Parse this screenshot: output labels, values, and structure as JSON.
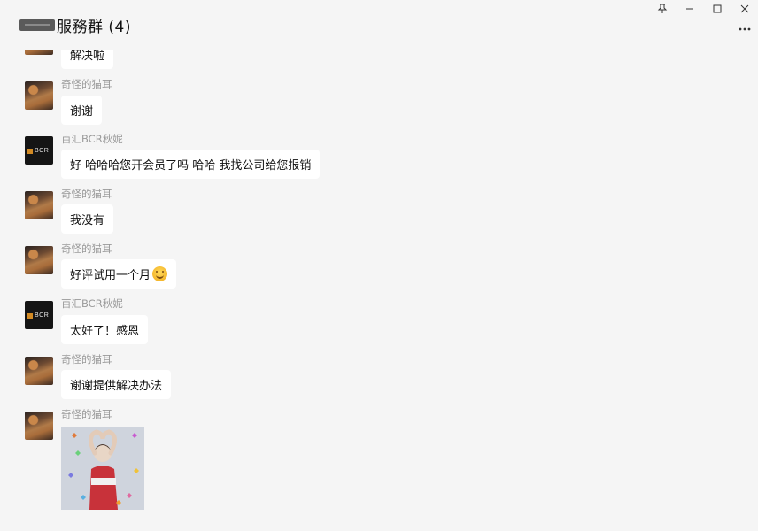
{
  "window": {
    "title": "服務群 (4)",
    "controls": [
      "pin-icon",
      "minimize-icon",
      "maximize-icon",
      "close-icon"
    ]
  },
  "messages": [
    {
      "sender": "",
      "avatar": "cat",
      "text": "解决啦",
      "partial": true
    },
    {
      "sender": "奇怪的猫耳",
      "avatar": "cat",
      "text": "谢谢"
    },
    {
      "sender": "百汇BCR秋妮",
      "avatar": "bcr",
      "text": "好 哈哈哈您开会员了吗 哈哈 我找公司给您报销"
    },
    {
      "sender": "奇怪的猫耳",
      "avatar": "cat",
      "text": "我没有"
    },
    {
      "sender": "奇怪的猫耳",
      "avatar": "cat",
      "text": "好评试用一个月",
      "emoji": "grinning-face"
    },
    {
      "sender": "百汇BCR秋妮",
      "avatar": "bcr",
      "text": "太好了！感恩"
    },
    {
      "sender": "奇怪的猫耳",
      "avatar": "cat",
      "text": "谢谢提供解决办法"
    },
    {
      "sender": "奇怪的猫耳",
      "avatar": "cat",
      "sticker": "heart-hands-sticker"
    }
  ],
  "bcr_logo_text": "BCR",
  "colors": {
    "background": "#f5f5f5",
    "bubble": "#ffffff",
    "sender": "#9a9a9a",
    "bcr_accent": "#d28a24"
  }
}
